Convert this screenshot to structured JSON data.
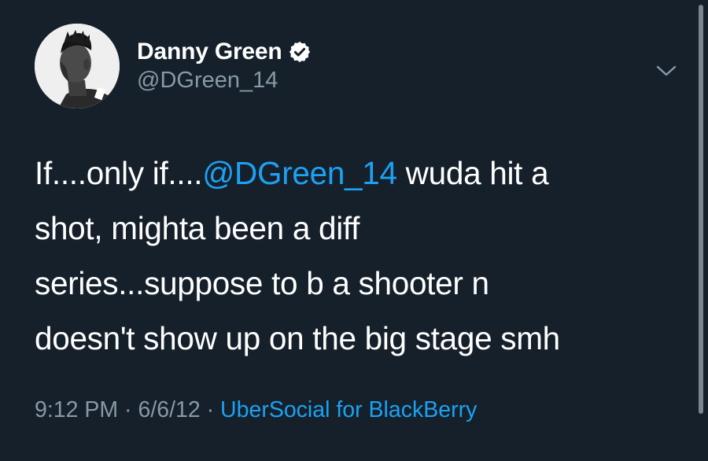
{
  "user": {
    "display_name": "Danny Green",
    "handle": "@DGreen_14"
  },
  "tweet": {
    "line1_pre": "If....only if....",
    "mention": "@DGreen_14",
    "line1_post": " wuda hit a",
    "line2": "shot, mighta been a diff",
    "line3": "series...suppose to b a shooter n",
    "line4": "doesn't show up on the big stage smh"
  },
  "meta": {
    "time": "9:12 PM",
    "separator1": " · ",
    "date": "6/6/12",
    "separator2": " · ",
    "source": "UberSocial for BlackBerry"
  },
  "icons": {
    "verified": "verified-badge-icon",
    "menu": "chevron-down-icon"
  },
  "colors": {
    "background": "#15202b",
    "link": "#1da1f2",
    "secondary_text": "#8899a6",
    "primary_text": "#ffffff"
  }
}
